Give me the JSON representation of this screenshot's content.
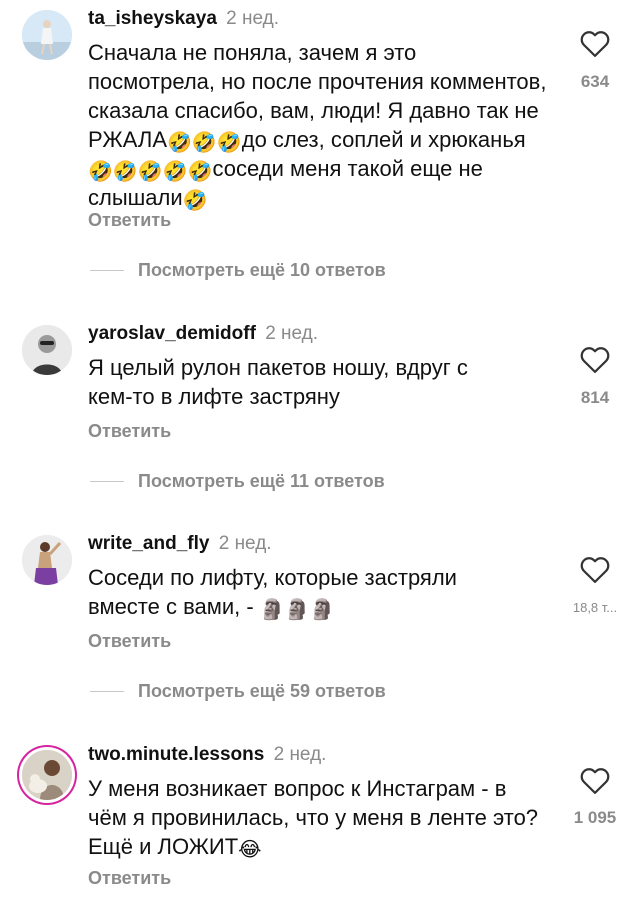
{
  "comments": [
    {
      "username": "ta_isheyskaya",
      "time": "2 нед.",
      "text_parts": [
        "Сначала не поняла, зачем я это посмотрела, но после прочтения комментов, сказала спасибо, вам, люди! Я давно так не РЖАЛА",
        "🤣🤣🤣",
        "до слез, соплей и хрюканья",
        "🤣🤣🤣🤣🤣",
        "соседи меня такой еще не слышали",
        "🤣"
      ],
      "likes": "634",
      "reply_label": "Ответить",
      "more_replies": "Посмотреть ещё 10 ответов"
    },
    {
      "username": "yaroslav_demidoff",
      "time": "2 нед.",
      "text_parts": [
        "Я целый рулон пакетов ношу, вдруг с кем-то в лифте застряну"
      ],
      "likes": "814",
      "reply_label": "Ответить",
      "more_replies": "Посмотреть ещё 11 ответов"
    },
    {
      "username": "write_and_fly",
      "time": "2 нед.",
      "text_parts": [
        "Соседи по лифту, которые застряли вместе с вами, - ",
        "🗿🗿🗿"
      ],
      "likes": "18,8 т...",
      "reply_label": "Ответить",
      "more_replies": "Посмотреть ещё 59 ответов"
    },
    {
      "username": "two.minute.lessons",
      "time": "2 нед.",
      "text_parts": [
        "У меня возникает вопрос к Инстаграм - в чём я провинилась, что у меня в ленте это? Ещё и ЛОЖИТ",
        "😂"
      ],
      "likes": "1 095",
      "reply_label": "Ответить"
    }
  ],
  "icons": {
    "like": "heart-outline-icon"
  },
  "colors": {
    "text": "#111111",
    "muted": "#8a8a8a",
    "story_ring": "#d6249f"
  }
}
